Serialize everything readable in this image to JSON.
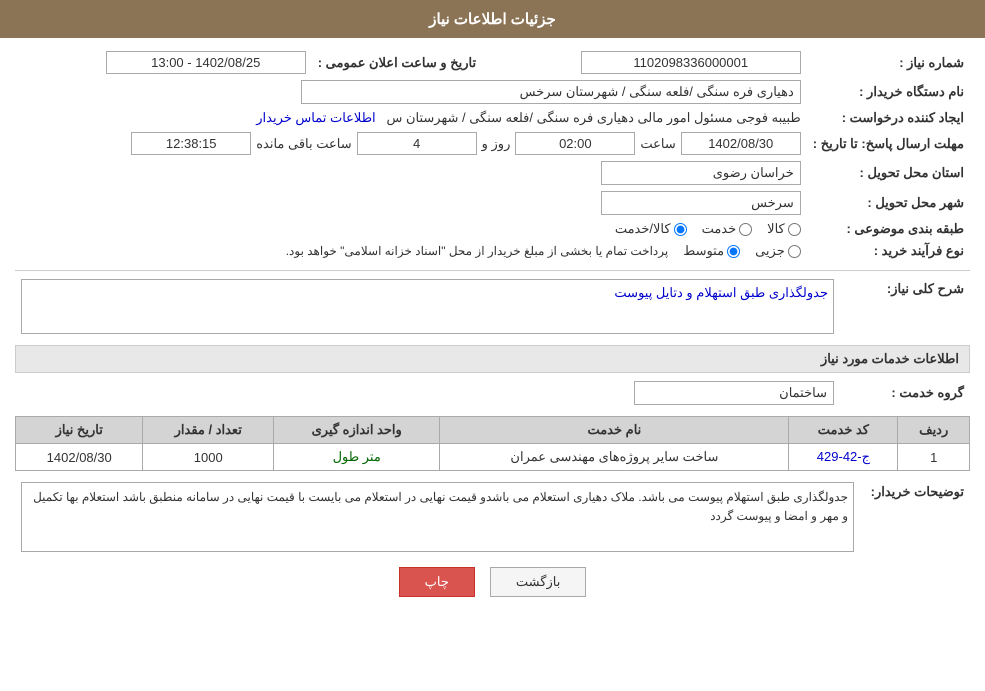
{
  "header": {
    "title": "جزئیات اطلاعات نیاز"
  },
  "fields": {
    "shomare_niaz_label": "شماره نیاز :",
    "shomare_niaz_value": "1102098336000001",
    "name_dastgah_label": "نام دستگاه خریدار :",
    "name_dastgah_value": "دهیاری فره سنگی /فلعه سنگی / شهرستان سرخس",
    "ijad_konande_label": "ایجاد کننده درخواست :",
    "ijad_konande_value": "طبیبه فوجی مسئول امور مالی دهیاری فره سنگی /فلعه سنگی / شهرستان س",
    "ettelaat_tamas_label": "اطلاعات تماس خریدار",
    "mohlat_ersal_label": "مهلت ارسال پاسخ: تا تاریخ :",
    "tarikh_value": "1402/08/30",
    "saat_label": "ساعت",
    "saat_value": "02:00",
    "rooz_label": "روز و",
    "rooz_value": "4",
    "baqi_mande_label": "ساعت باقی مانده",
    "baqi_mande_value": "12:38:15",
    "tarikh_elan_label": "تاریخ و ساعت اعلان عمومی :",
    "tarikh_elan_value": "1402/08/25 - 13:00",
    "ostan_label": "استان محل تحویل :",
    "ostan_value": "خراسان رضوی",
    "shahr_label": "شهر محل تحویل :",
    "shahr_value": "سرخس",
    "tabaqe_label": "طبقه بندی موضوعی :",
    "tabaqe_kala": "کالا",
    "tabaqe_khadamat": "خدمت",
    "tabaqe_kala_khadamat": "کالا/خدمت",
    "type_farayand_label": "نوع فرآیند خرید :",
    "type_jozei": "جزیی",
    "type_motovaset": "متوسط",
    "type_note": "پرداخت تمام یا بخشی از مبلغ خریدار از محل \"اسناد خزانه اسلامی\" خواهد بود.",
    "sherh_label": "شرح کلی نیاز:",
    "sherh_value": "جدولگذاری طبق استهلام و دتایل پیوست",
    "service_info_label": "اطلاعات خدمات مورد نیاز",
    "grooh_khadamat_label": "گروه خدمت :",
    "grooh_khadamat_value": "ساختمان",
    "table_headers": {
      "radif": "ردیف",
      "kod": "کد خدمت",
      "name": "نام خدمت",
      "vahed": "واحد اندازه گیری",
      "tedad": "تعداد / مقدار",
      "tarikh": "تاریخ نیاز"
    },
    "table_rows": [
      {
        "radif": "1",
        "kod": "ج-42-429",
        "name": "ساخت سایر پروژه‌های مهندسی عمران",
        "vahed": "متر طول",
        "tedad": "1000",
        "tarikh": "1402/08/30"
      }
    ],
    "tozihat_label": "توضیحات خریدار:",
    "tozihat_value": "جدولگذاری طبق استهلام  پیوست می باشد. ملاک  دهیاری استعلام  می باشدو قیمت نهایی در استعلام می بایست با قیمت  نهایی در سامانه  منطبق باشد استعلام  بها  تکمیل  و مهر و امضا و پیوست  گردد",
    "btn_back": "بازگشت",
    "btn_print": "چاپ"
  }
}
